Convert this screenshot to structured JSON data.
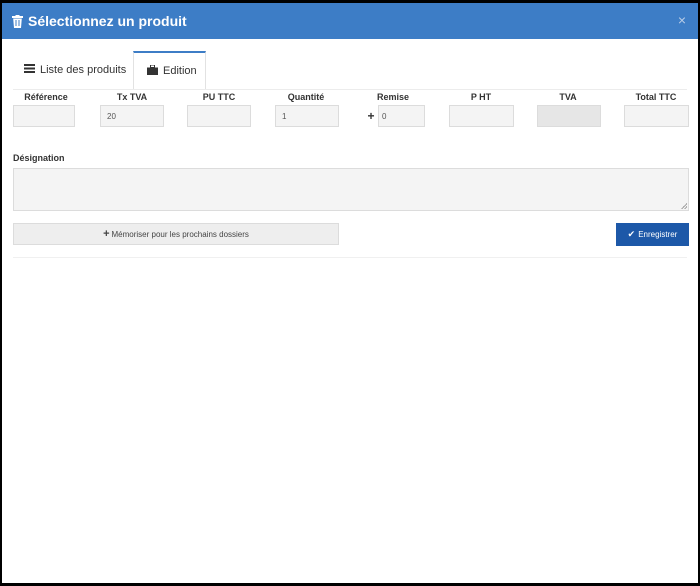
{
  "modal": {
    "title": "Sélectionnez un produit",
    "close_label": "×"
  },
  "tabs": [
    {
      "label": "Liste des produits",
      "icon": "list-icon",
      "active": false
    },
    {
      "label": "Edition",
      "icon": "briefcase-icon",
      "active": true
    }
  ],
  "fields": {
    "reference": {
      "label": "Référence",
      "value": ""
    },
    "tx_tva": {
      "label": "Tx TVA",
      "value": "20"
    },
    "pu_ttc": {
      "label": "PU TTC",
      "value": ""
    },
    "quantite": {
      "label": "Quantité",
      "value": "1"
    },
    "remise": {
      "label": "Remise",
      "value": "0",
      "addon": "+"
    },
    "p_ht": {
      "label": "P HT",
      "value": ""
    },
    "tva": {
      "label": "TVA",
      "value": ""
    },
    "total_ttc": {
      "label": "Total TTC",
      "value": ""
    }
  },
  "designation": {
    "label": "Désignation",
    "value": ""
  },
  "buttons": {
    "memorize": "Mémoriser pour les prochains dossiers",
    "memorize_icon": "plus-icon",
    "save": "Enregistrer",
    "save_icon": "check-icon"
  },
  "colors": {
    "header": "#3d7dc6",
    "save_button": "#1d58a8"
  }
}
